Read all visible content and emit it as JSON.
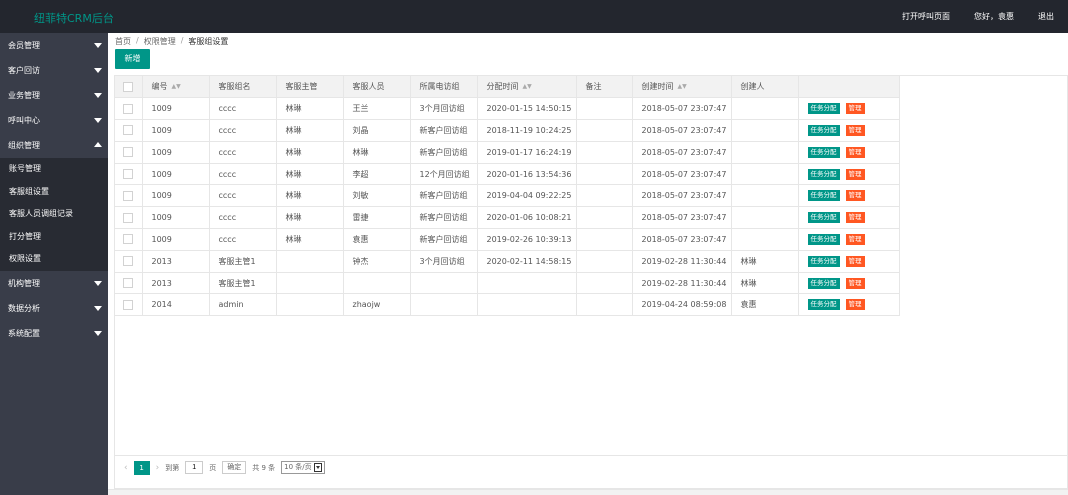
{
  "header": {
    "brand": "纽菲特CRM后台",
    "nav": [
      "打开呼叫页面",
      "您好，袁惠",
      "退出"
    ]
  },
  "sidebar": {
    "items_top": [
      "会员管理",
      "客户回访",
      "业务管理",
      "呼叫中心"
    ],
    "open_item": "组织管理",
    "sub_items": [
      "账号管理",
      "客服组设置",
      "客服人员调组记录",
      "打分管理",
      "权限设置"
    ],
    "items_bottom": [
      "机构管理",
      "数据分析",
      "系统配置"
    ]
  },
  "breadcrumb": [
    "首页",
    "权限管理",
    "客服组设置"
  ],
  "add_button": "新增",
  "table": {
    "columns": [
      "编号",
      "客服组名",
      "客服主管",
      "客服人员",
      "所属电访组",
      "分配时间",
      "备注",
      "创建时间",
      "创建人",
      ""
    ],
    "sortable": [
      true,
      false,
      false,
      false,
      false,
      true,
      false,
      true,
      false,
      false
    ],
    "rows": [
      [
        "1009",
        "cccc",
        "林琳",
        "王兰",
        "3个月回访组",
        "2020-01-15 14:50:15",
        "",
        "2018-05-07 23:07:47",
        ""
      ],
      [
        "1009",
        "cccc",
        "林琳",
        "刘晶",
        "新客户回访组",
        "2018-11-19 10:24:25",
        "",
        "2018-05-07 23:07:47",
        ""
      ],
      [
        "1009",
        "cccc",
        "林琳",
        "林琳",
        "新客户回访组",
        "2019-01-17 16:24:19",
        "",
        "2018-05-07 23:07:47",
        ""
      ],
      [
        "1009",
        "cccc",
        "林琳",
        "李超",
        "12个月回访组",
        "2020-01-16 13:54:36",
        "",
        "2018-05-07 23:07:47",
        ""
      ],
      [
        "1009",
        "cccc",
        "林琳",
        "刘敏",
        "新客户回访组",
        "2019-04-04 09:22:25",
        "",
        "2018-05-07 23:07:47",
        ""
      ],
      [
        "1009",
        "cccc",
        "林琳",
        "雷捷",
        "新客户回访组",
        "2020-01-06 10:08:21",
        "",
        "2018-05-07 23:07:47",
        ""
      ],
      [
        "1009",
        "cccc",
        "林琳",
        "袁惠",
        "新客户回访组",
        "2019-02-26 10:39:13",
        "",
        "2018-05-07 23:07:47",
        ""
      ],
      [
        "2013",
        "客服主管1",
        "",
        "钟杰",
        "3个月回访组",
        "2020-02-11 14:58:15",
        "",
        "2019-02-28 11:30:44",
        "林琳"
      ],
      [
        "2013",
        "客服主管1",
        "",
        "",
        "",
        "",
        "",
        "2019-02-28 11:30:44",
        "林琳"
      ],
      [
        "2014",
        "admin",
        "",
        "zhaojw",
        "",
        "",
        "",
        "2019-04-24 08:59:08",
        "袁惠"
      ]
    ],
    "op_assign": "任务分配",
    "op_manage": "管理"
  },
  "pager": {
    "current": "1",
    "goto_label": "到第",
    "goto_value": "1",
    "page_unit": "页",
    "confirm": "确定",
    "total": "共 9 条",
    "page_size": "10 条/页"
  }
}
